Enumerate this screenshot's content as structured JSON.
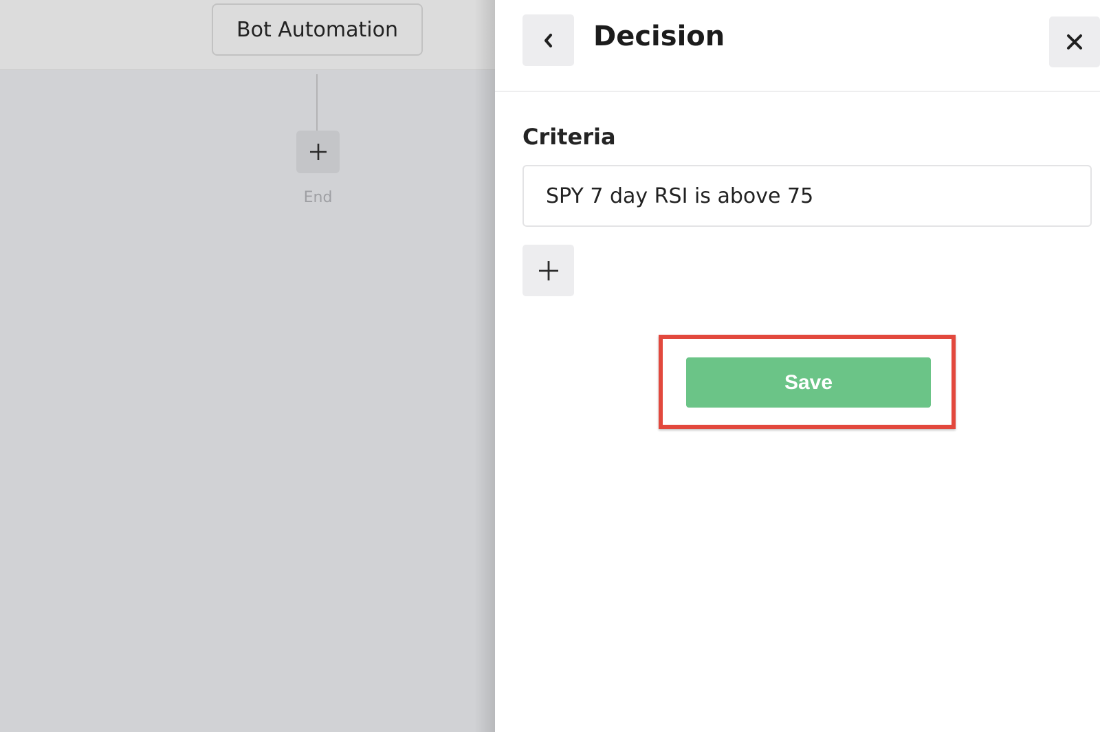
{
  "canvas": {
    "bot_node_label": "Bot Automation",
    "end_label": "End"
  },
  "panel": {
    "title": "Decision",
    "criteria_label": "Criteria",
    "criteria_value": "SPY 7 day RSI is above 75",
    "save_label": "Save"
  },
  "icons": {
    "back": "chevron-left-icon",
    "close": "close-icon",
    "add": "plus-icon"
  },
  "colors": {
    "save_button": "#6bc487",
    "highlight": "#e2483d"
  }
}
